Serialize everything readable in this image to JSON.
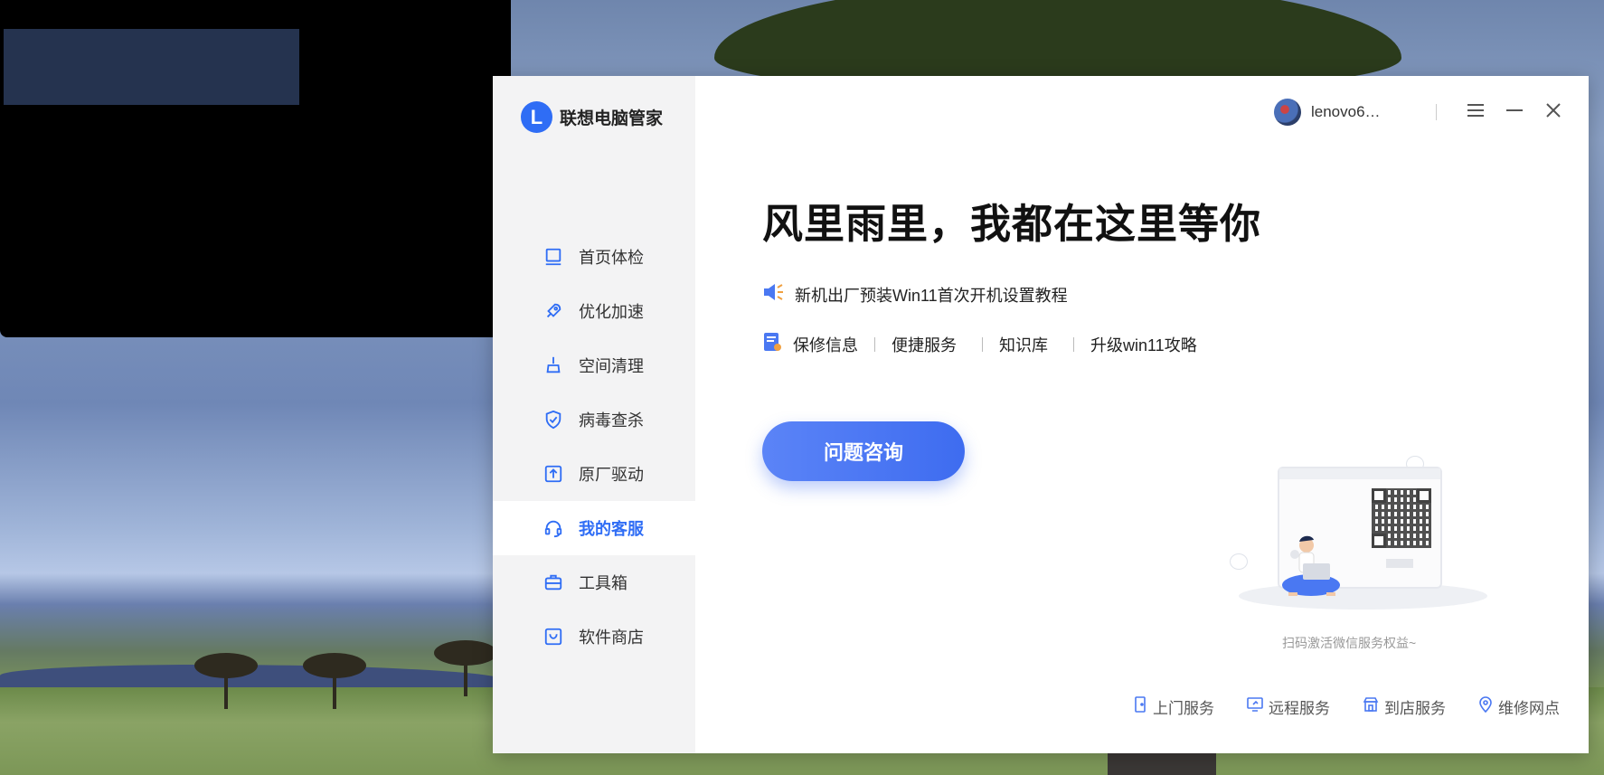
{
  "app": {
    "brand_name": "联想电脑管家",
    "brand_letter": "L"
  },
  "sidebar": {
    "items": [
      {
        "label": "首页体检",
        "icon": "laptop-icon"
      },
      {
        "label": "优化加速",
        "icon": "rocket-icon"
      },
      {
        "label": "空间清理",
        "icon": "broom-icon"
      },
      {
        "label": "病毒查杀",
        "icon": "shield-check-icon"
      },
      {
        "label": "原厂驱动",
        "icon": "upload-box-icon"
      },
      {
        "label": "我的客服",
        "icon": "headset-icon",
        "active": true
      },
      {
        "label": "工具箱",
        "icon": "toolbox-icon"
      },
      {
        "label": "软件商店",
        "icon": "shopping-bag-icon"
      }
    ]
  },
  "header": {
    "username": "lenovo6…",
    "menu_icon": "hamburger-icon",
    "minimize_icon": "minimize-icon",
    "close_icon": "close-icon"
  },
  "main": {
    "headline": "风里雨里，我都在这里等你",
    "notice": "新机出厂预装Win11首次开机设置教程",
    "links": [
      "保修信息",
      "便捷服务",
      "知识库",
      "升级win11攻略"
    ],
    "consult_button": "问题咨询",
    "scan_text": "扫码激活微信服务权益~"
  },
  "footer": {
    "services": [
      {
        "label": "上门服务",
        "icon": "door-icon"
      },
      {
        "label": "远程服务",
        "icon": "remote-screen-icon"
      },
      {
        "label": "到店服务",
        "icon": "store-icon"
      },
      {
        "label": "维修网点",
        "icon": "location-pin-icon"
      }
    ]
  },
  "colors": {
    "accent": "#2f6df5",
    "button_gradient_start": "#5b84f7",
    "button_gradient_end": "#3e6cf0",
    "sidebar_bg": "#f3f3f4"
  }
}
